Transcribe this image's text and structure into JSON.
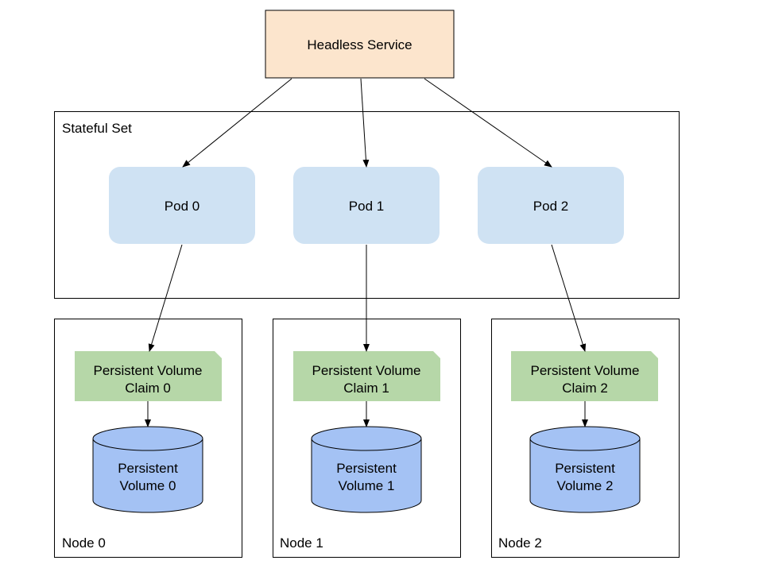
{
  "colors": {
    "service_fill": "#fce5cd",
    "pod_fill": "#cfe2f3",
    "pvc_fill": "#b6d7a8",
    "pv_fill": "#a4c2f4",
    "stroke": "#000000"
  },
  "service": {
    "label": "Headless Service"
  },
  "statefulset": {
    "label": "Stateful Set",
    "pods": [
      {
        "label": "Pod 0"
      },
      {
        "label": "Pod 1"
      },
      {
        "label": "Pod 2"
      }
    ]
  },
  "nodes": [
    {
      "label": "Node 0",
      "pvc": [
        "Persistent Volume",
        "Claim 0"
      ],
      "pv": [
        "Persistent",
        "Volume 0"
      ]
    },
    {
      "label": "Node 1",
      "pvc": [
        "Persistent Volume",
        "Claim 1"
      ],
      "pv": [
        "Persistent",
        "Volume 1"
      ]
    },
    {
      "label": "Node 2",
      "pvc": [
        "Persistent Volume",
        "Claim 2"
      ],
      "pv": [
        "Persistent",
        "Volume 2"
      ]
    }
  ]
}
